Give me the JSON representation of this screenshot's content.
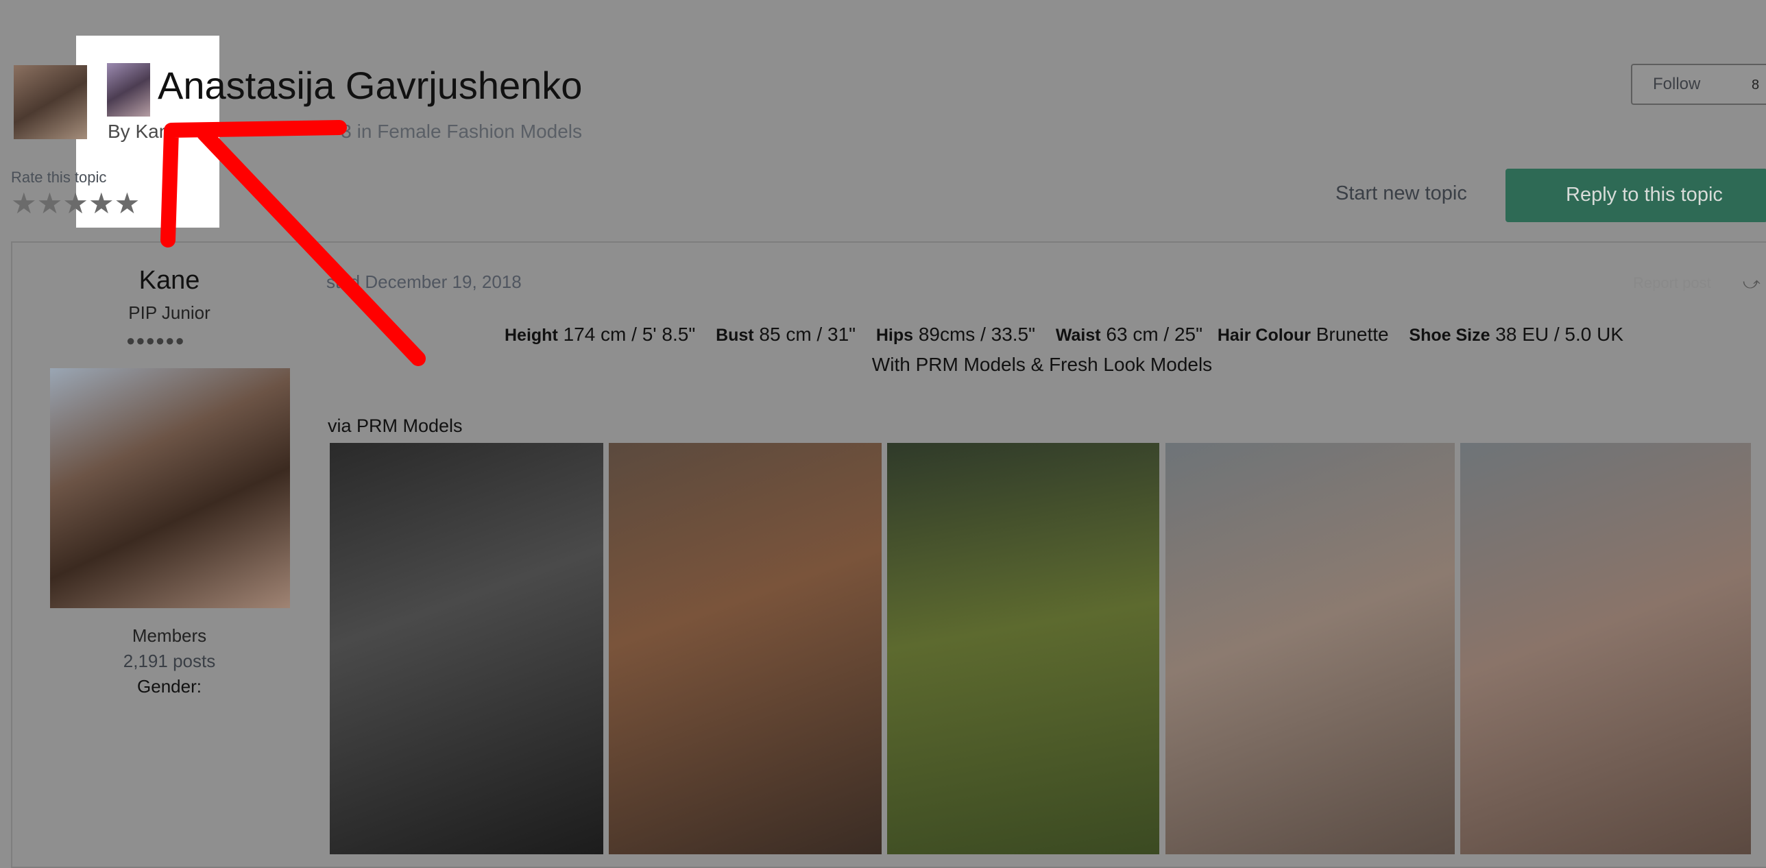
{
  "topic": {
    "title": "Anastasija Gavrjushenko",
    "byline_prefix": "By Kan",
    "byline_rest": "3 in Female Fashion Models",
    "rate_label": "Rate this topic",
    "stars": "★★★★★",
    "follow_label": "Follow",
    "follow_count": "8",
    "start_topic_label": "Start new topic",
    "reply_label": "Reply to this topic"
  },
  "author": {
    "name": "Kane",
    "rank": "PIP Junior",
    "rank_dots": "●●●●●●",
    "group": "Members",
    "posts": "2,191 posts",
    "gender_label": "Gender:"
  },
  "post": {
    "posted": "sted December 19, 2018",
    "report_label": "Report post",
    "share_icon": "share-icon",
    "stats": {
      "height_label": "Height",
      "height_value": "174 cm / 5' 8.5\"",
      "bust_label": "Bust",
      "bust_value": "85 cm / 31\"",
      "hips_label": "Hips",
      "hips_value": "89cms / 33.5\"",
      "waist_label": "Waist",
      "waist_value": "63 cm / 25\"",
      "hair_label": "Hair Colour",
      "hair_value": "Brunette",
      "shoe_label": "Shoe Size",
      "shoe_value": "38 EU / 5.0 UK"
    },
    "agency_line": "With PRM Models & Fresh Look Models",
    "via": "via PRM Models"
  },
  "colors": {
    "reply_button": "#2e6a55",
    "annotation_arrow": "#ff0000",
    "overlay": "#8f8f8f"
  }
}
